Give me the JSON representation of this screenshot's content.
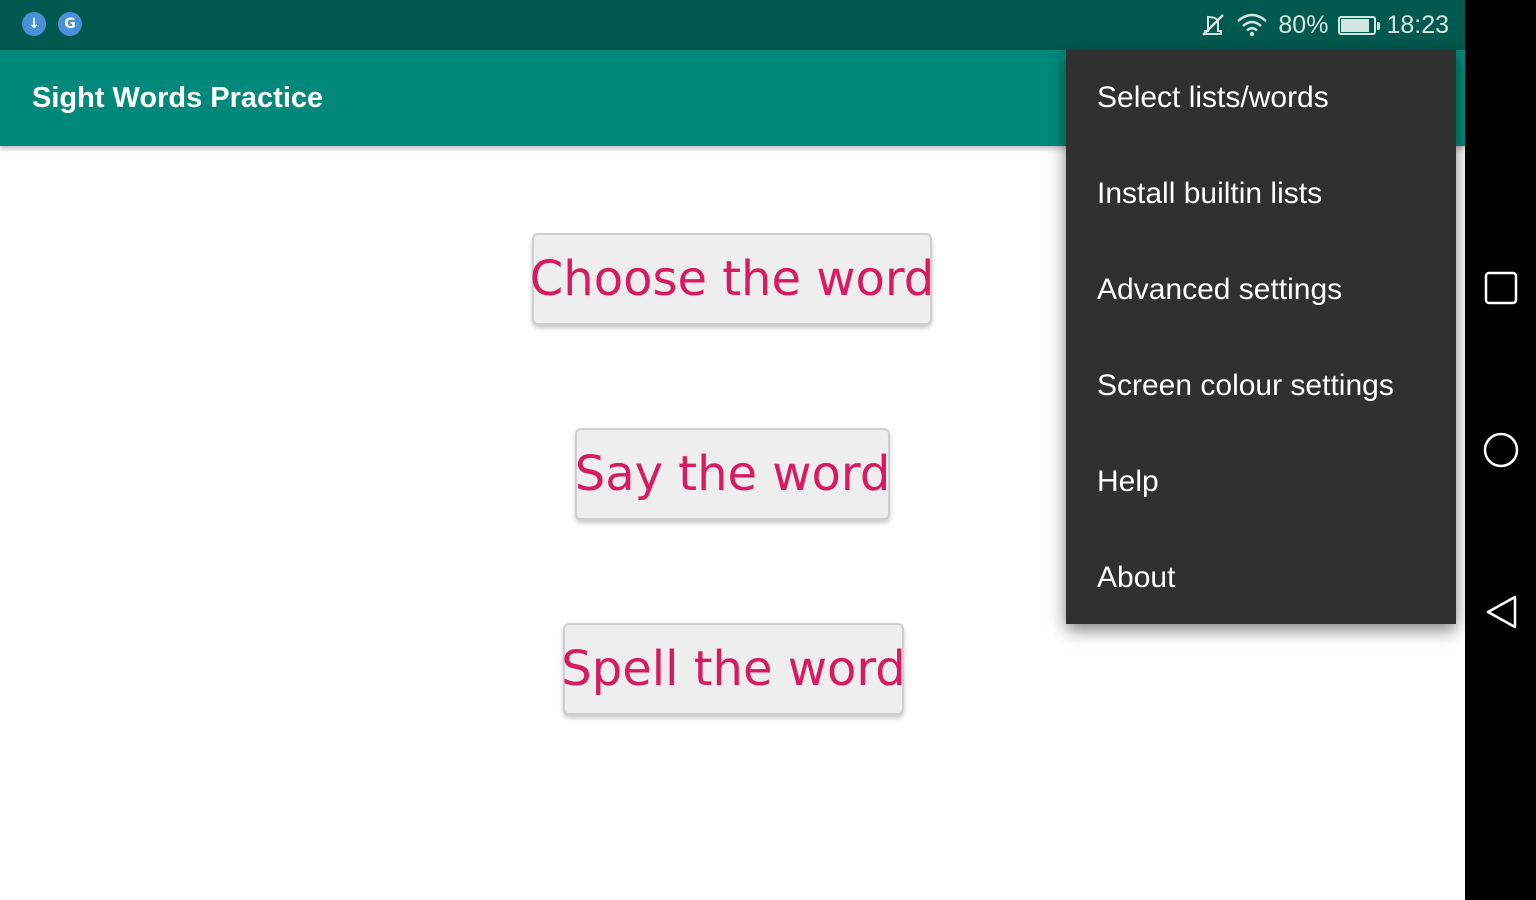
{
  "status_bar": {
    "left_icons": [
      "download-notification-icon",
      "sync-notification-icon"
    ],
    "right_icons": [
      "mute-icon",
      "wifi-icon",
      "battery-icon"
    ],
    "battery_text": "80%",
    "battery_level": 0.8,
    "time": "18:23",
    "color": "#00594f"
  },
  "app_bar": {
    "title": "Sight Words Practice",
    "color": "#00897b"
  },
  "main": {
    "buttons": [
      {
        "label": "Choose the word"
      },
      {
        "label": "Say the word"
      },
      {
        "label": "Spell the word"
      }
    ],
    "button_text_color": "#d81b60"
  },
  "overflow_menu": {
    "items": [
      {
        "label": "Select lists/words"
      },
      {
        "label": "Install builtin lists"
      },
      {
        "label": "Advanced settings"
      },
      {
        "label": "Screen colour settings"
      },
      {
        "label": "Help"
      },
      {
        "label": "About"
      }
    ],
    "background": "#303030"
  },
  "nav_bar": {
    "buttons": [
      "recents-icon",
      "home-icon",
      "back-icon"
    ]
  }
}
